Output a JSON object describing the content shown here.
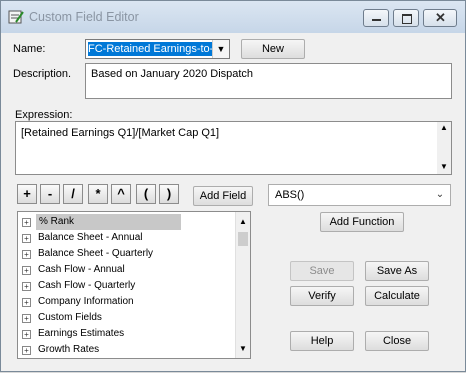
{
  "window": {
    "title": "Custom Field Editor"
  },
  "form": {
    "name_label": "Name:",
    "name_value": "FC-Retained Earnings-to-",
    "new_button": "New",
    "description_label": "Description.",
    "description_value": "Based on January 2020 Dispatch",
    "expression_label": "Expression:",
    "expression_value": "[Retained Earnings Q1]/[Market Cap Q1]"
  },
  "operators": [
    "+",
    "-",
    "/",
    "*",
    "^",
    "(",
    ")"
  ],
  "add_field_button": "Add Field",
  "function_select": {
    "value": "ABS()"
  },
  "add_function_button": "Add Function",
  "tree": {
    "items": [
      {
        "label": "% Rank"
      },
      {
        "label": "Balance Sheet - Annual"
      },
      {
        "label": "Balance Sheet - Quarterly"
      },
      {
        "label": "Cash Flow - Annual"
      },
      {
        "label": "Cash Flow - Quarterly"
      },
      {
        "label": "Company Information"
      },
      {
        "label": "Custom Fields"
      },
      {
        "label": "Earnings Estimates"
      },
      {
        "label": "Growth Rates"
      }
    ]
  },
  "actions": {
    "save": "Save",
    "save_as": "Save As",
    "verify": "Verify",
    "calculate": "Calculate",
    "help": "Help",
    "close": "Close"
  },
  "colors": {
    "selection": "#0078d7",
    "tree_highlight": "#c8c8c8",
    "disabled_text": "#8c8c8c"
  }
}
